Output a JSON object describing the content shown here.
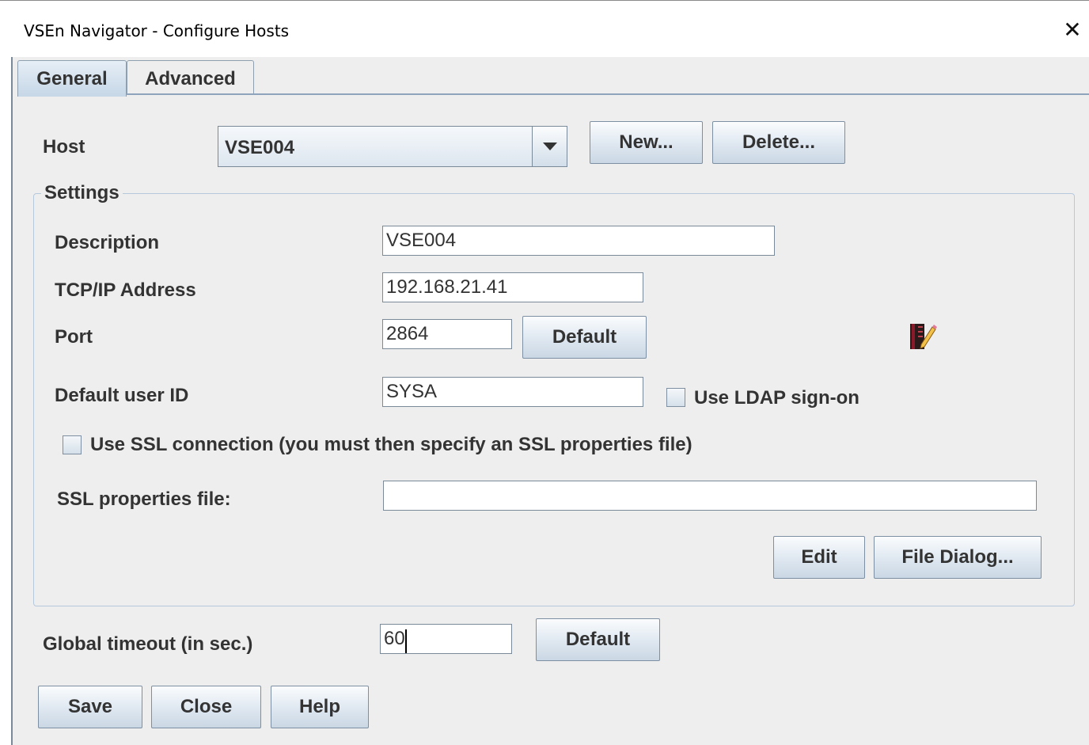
{
  "window": {
    "title": "VSEn Navigator -  Configure Hosts",
    "close_glyph": "✕"
  },
  "tabs": [
    {
      "label": "General",
      "active": true
    },
    {
      "label": "Advanced",
      "active": false
    }
  ],
  "host": {
    "label": "Host",
    "selected": "VSE004",
    "new_button": "New...",
    "delete_button": "Delete..."
  },
  "settings": {
    "legend": "Settings",
    "description_label": "Description",
    "description_value": "VSE004",
    "tcpip_label": "TCP/IP Address",
    "tcpip_value": "192.168.21.41",
    "port_label": "Port",
    "port_value": "2864",
    "port_default_button": "Default",
    "userid_label": "Default user ID",
    "userid_value": "SYSA",
    "ldap_label": "Use LDAP sign-on",
    "ldap_checked": false,
    "ssl_label": "Use SSL connection (you must then specify an SSL properties file)",
    "ssl_checked": false,
    "sslfile_label": "SSL properties file:",
    "sslfile_value": "",
    "edit_button": "Edit",
    "file_dialog_button": "File Dialog..."
  },
  "timeout": {
    "label": "Global timeout (in sec.)",
    "value": "60",
    "default_button": "Default"
  },
  "footer": {
    "save": "Save",
    "close": "Close",
    "help": "Help"
  },
  "icons": {
    "edit_icon": "notebook-pencil-icon",
    "dropdown": "triangle-down-icon"
  },
  "colors": {
    "tab_active": "#c6d7e7",
    "button_gradient_end": "#cad7e4",
    "panel": "#eeeeee"
  }
}
